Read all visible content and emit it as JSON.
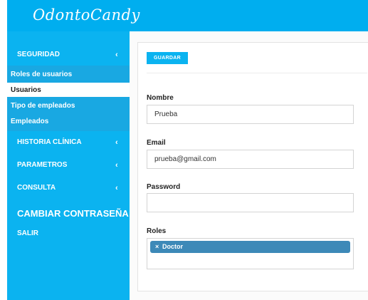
{
  "header": {
    "logo_text": "OdontoCandy"
  },
  "sidebar": {
    "items": [
      {
        "label": "SEGURIDAD",
        "chevron": "‹"
      },
      {
        "label": "HISTORIA CLÍNICA",
        "chevron": "‹"
      },
      {
        "label": "PARAMETROS",
        "chevron": "‹"
      },
      {
        "label": "CONSULTA",
        "chevron": "‹"
      },
      {
        "label": "CAMBIAR CONTRASEÑA"
      },
      {
        "label": "SALIR"
      }
    ],
    "submenu": [
      {
        "label": "Roles de usuarios"
      },
      {
        "label": "Usuarios",
        "active": true
      },
      {
        "label": "Tipo de empleados"
      },
      {
        "label": "Empleados"
      }
    ]
  },
  "form": {
    "save_label": "GUARDAR",
    "nombre": {
      "label": "Nombre",
      "value": "Prueba"
    },
    "email": {
      "label": "Email",
      "value": "prueba@gmail.com"
    },
    "password": {
      "label": "Password",
      "value": ""
    },
    "roles": {
      "label": "Roles",
      "selected": [
        {
          "remove": "×",
          "label": "Doctor"
        }
      ]
    }
  },
  "colors": {
    "brand": "#00aeef",
    "sidebar": "#0bb3f0",
    "submenu": "#19a8e2",
    "chip": "#3d89b8"
  }
}
